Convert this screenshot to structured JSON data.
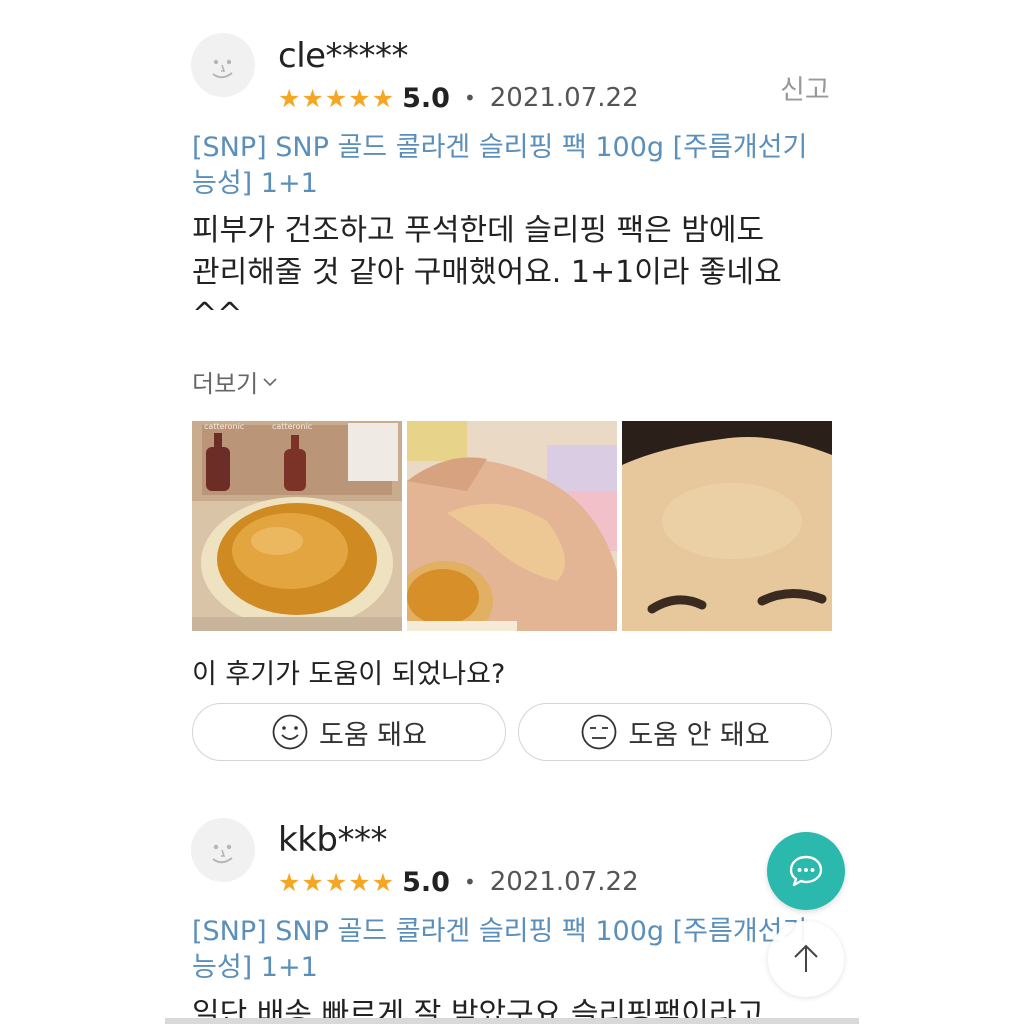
{
  "reviews": [
    {
      "username": "cle*****",
      "stars": [
        "★",
        "★",
        "★",
        "★",
        "★"
      ],
      "score": "5.0",
      "separator": "•",
      "date": "2021.07.22",
      "report_label": "신고",
      "product_line1": "[SNP] SNP 골드 콜라겐 슬리핑 팩 100g [주름개선기",
      "product_line2": "능성] 1+1",
      "body_line1": "피부가 건조하고 푸석한데 슬리핑 팩은 밤에도",
      "body_line2": "관리해줄 것 같아 구매했어요. 1+1이라 좋네요",
      "body_line3": "^^",
      "more_label": "더보기",
      "helpful_question": "이 후기가 도움이 되었나요?",
      "helpful_label": "도움 돼요",
      "not_helpful_label": "도움 안 돼요"
    },
    {
      "username": "kkb***",
      "stars": [
        "★",
        "★",
        "★",
        "★",
        "★"
      ],
      "score": "5.0",
      "separator": "•",
      "date": "2021.07.22",
      "product_line1": "[SNP] SNP 골드 콜라겐 슬리핑 팩 100g [주름개선기",
      "product_line2": "능성] 1+1",
      "body_line1": "일단 배송 빠르게 잘 받았구요 슬리핑팩이라고"
    }
  ],
  "photo_labels": {
    "brand_a": "catteronic",
    "brand_b": "catteronic"
  },
  "colors": {
    "star": "#f5a623",
    "product_link": "#5b8fb9",
    "chat_fab": "#2bb8ad"
  },
  "icons": {
    "chat": "chat-bubble-icon",
    "top": "arrow-up-icon",
    "smile": "smile-face-icon",
    "neutral": "neutral-face-icon"
  }
}
